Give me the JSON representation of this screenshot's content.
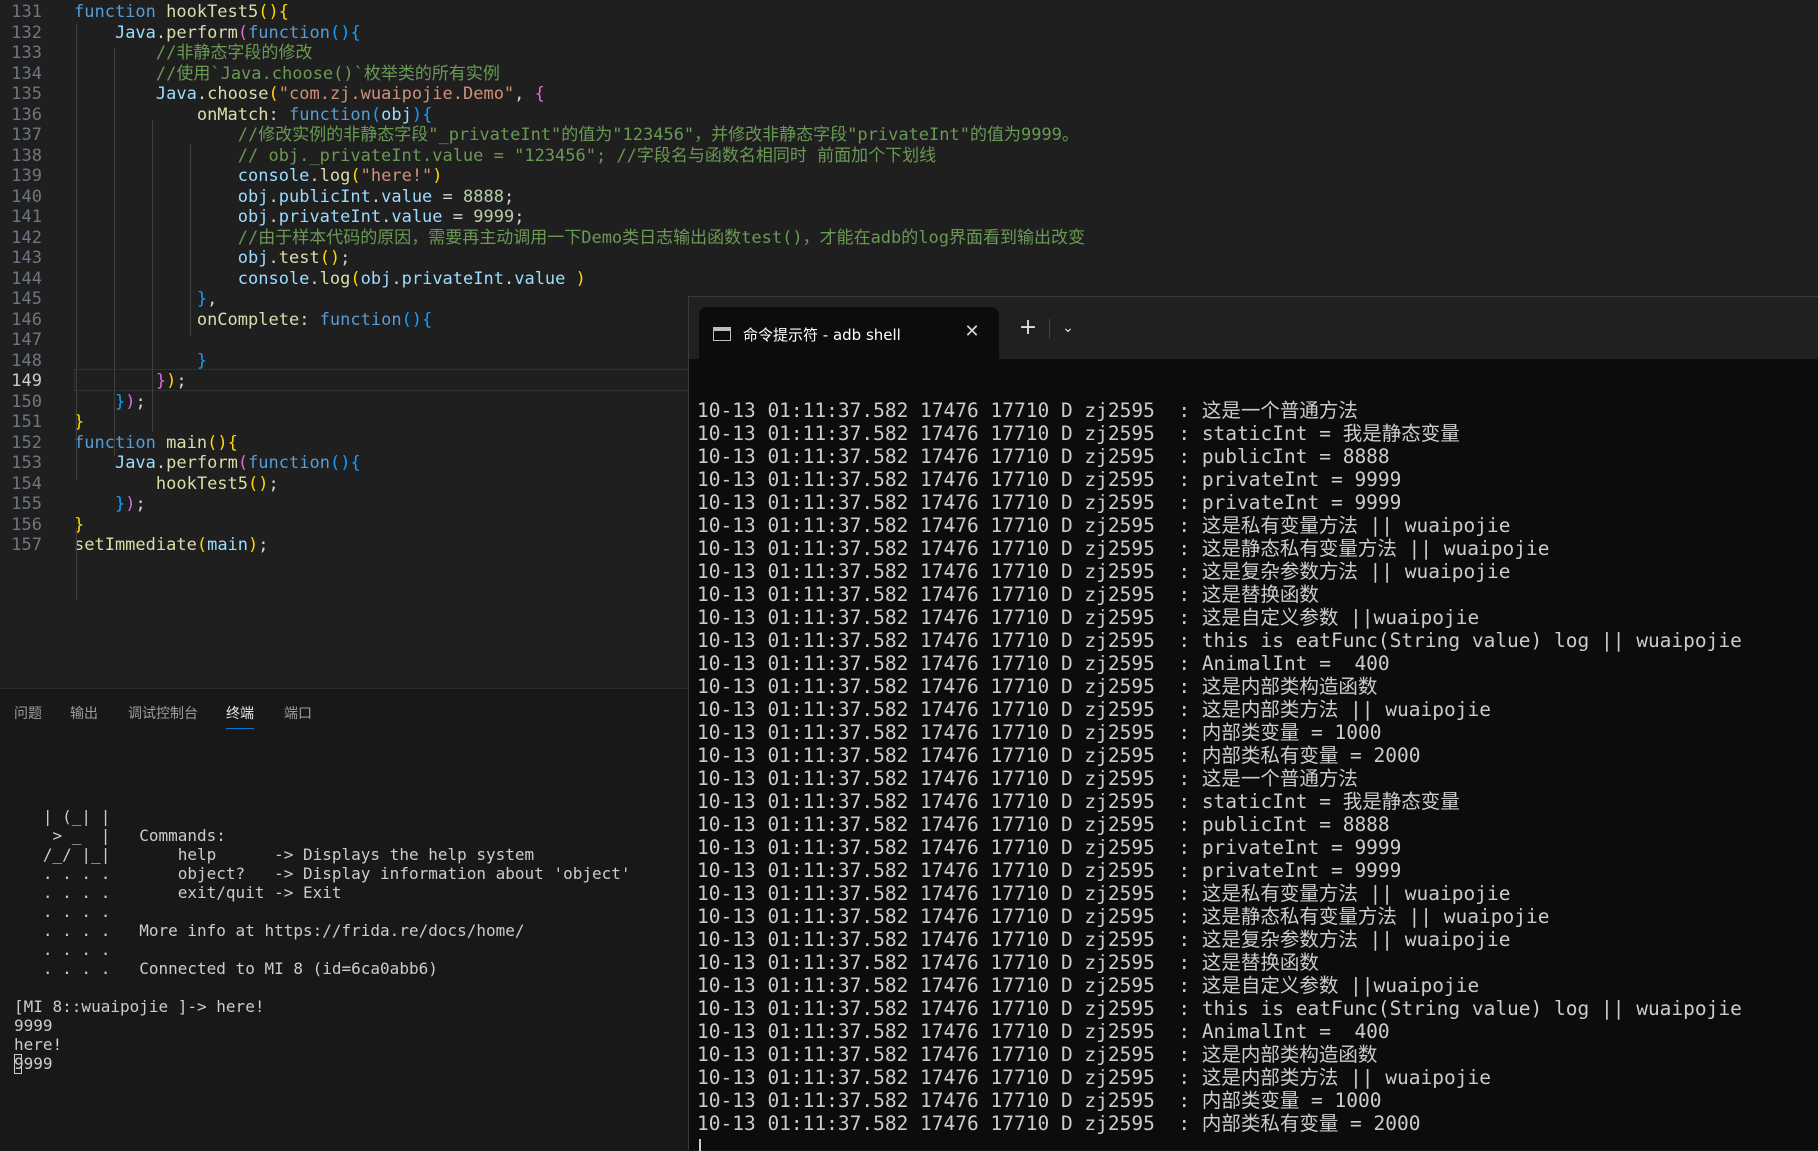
{
  "editor": {
    "lines": [
      {
        "num": "131",
        "tokens": [
          [
            "kw",
            "function "
          ],
          [
            "fn",
            "hookTest5"
          ],
          [
            "b1",
            "()"
          ],
          [
            "b1",
            "{"
          ]
        ]
      },
      {
        "num": "132",
        "tokens": [
          [
            "pl",
            "    "
          ],
          [
            "var",
            "Java"
          ],
          [
            "pl",
            "."
          ],
          [
            "fn",
            "perform"
          ],
          [
            "b2",
            "("
          ],
          [
            "kw",
            "function"
          ],
          [
            "b3",
            "()"
          ],
          [
            "b3",
            "{"
          ]
        ]
      },
      {
        "num": "133",
        "tokens": [
          [
            "cm",
            "        //非静态字段的修改"
          ]
        ]
      },
      {
        "num": "134",
        "tokens": [
          [
            "cm",
            "        //使用`Java.choose()`枚举类的所有实例"
          ]
        ]
      },
      {
        "num": "135",
        "tokens": [
          [
            "pl",
            "        "
          ],
          [
            "var",
            "Java"
          ],
          [
            "pl",
            "."
          ],
          [
            "fn",
            "choose"
          ],
          [
            "b1",
            "("
          ],
          [
            "str",
            "\"com.zj.wuaipojie.Demo\""
          ],
          [
            "pl",
            ", "
          ],
          [
            "b2",
            "{"
          ]
        ]
      },
      {
        "num": "136",
        "tokens": [
          [
            "pl",
            "            "
          ],
          [
            "fn",
            "onMatch"
          ],
          [
            "pl",
            ": "
          ],
          [
            "kw",
            "function"
          ],
          [
            "b3",
            "("
          ],
          [
            "var",
            "obj"
          ],
          [
            "b3",
            ")"
          ],
          [
            "b3",
            "{"
          ]
        ]
      },
      {
        "num": "137",
        "tokens": [
          [
            "cm",
            "                //修改实例的非静态字段\"_privateInt\"的值为\"123456\"，并修改非静态字段\"privateInt\"的值为9999。"
          ]
        ]
      },
      {
        "num": "138",
        "tokens": [
          [
            "cm",
            "                // obj._privateInt.value = \"123456\"; //字段名与函数名相同时 前面加个下划线"
          ]
        ]
      },
      {
        "num": "139",
        "tokens": [
          [
            "pl",
            "                "
          ],
          [
            "var",
            "console"
          ],
          [
            "pl",
            "."
          ],
          [
            "fn",
            "log"
          ],
          [
            "b1",
            "("
          ],
          [
            "str",
            "\"here!\""
          ],
          [
            "b1",
            ")"
          ]
        ]
      },
      {
        "num": "140",
        "tokens": [
          [
            "pl",
            "                "
          ],
          [
            "var",
            "obj"
          ],
          [
            "pl",
            "."
          ],
          [
            "var",
            "publicInt"
          ],
          [
            "pl",
            "."
          ],
          [
            "var",
            "value"
          ],
          [
            "pl",
            " = "
          ],
          [
            "num",
            "8888"
          ],
          [
            "pl",
            ";"
          ]
        ]
      },
      {
        "num": "141",
        "tokens": [
          [
            "pl",
            "                "
          ],
          [
            "var",
            "obj"
          ],
          [
            "pl",
            "."
          ],
          [
            "var",
            "privateInt"
          ],
          [
            "pl",
            "."
          ],
          [
            "var",
            "value"
          ],
          [
            "pl",
            " = "
          ],
          [
            "num",
            "9999"
          ],
          [
            "pl",
            ";"
          ]
        ]
      },
      {
        "num": "142",
        "tokens": [
          [
            "cm",
            "                //由于样本代码的原因，需要再主动调用一下Demo类日志输出函数test()，才能在adb的log界面看到输出改变"
          ]
        ]
      },
      {
        "num": "143",
        "tokens": [
          [
            "pl",
            "                "
          ],
          [
            "var",
            "obj"
          ],
          [
            "pl",
            "."
          ],
          [
            "fn",
            "test"
          ],
          [
            "b1",
            "()"
          ],
          [
            "pl",
            ";"
          ]
        ]
      },
      {
        "num": "144",
        "tokens": [
          [
            "pl",
            "                "
          ],
          [
            "var",
            "console"
          ],
          [
            "pl",
            "."
          ],
          [
            "fn",
            "log"
          ],
          [
            "b1",
            "("
          ],
          [
            "var",
            "obj"
          ],
          [
            "pl",
            "."
          ],
          [
            "var",
            "privateInt"
          ],
          [
            "pl",
            "."
          ],
          [
            "var",
            "value"
          ],
          [
            "pl",
            " "
          ],
          [
            "b1",
            ")"
          ]
        ]
      },
      {
        "num": "145",
        "tokens": [
          [
            "pl",
            "            "
          ],
          [
            "b3",
            "}"
          ],
          [
            "pl",
            ","
          ]
        ]
      },
      {
        "num": "146",
        "tokens": [
          [
            "pl",
            "            "
          ],
          [
            "fn",
            "onComplete"
          ],
          [
            "pl",
            ": "
          ],
          [
            "kw",
            "function"
          ],
          [
            "b3",
            "()"
          ],
          [
            "b3",
            "{"
          ]
        ]
      },
      {
        "num": "147",
        "tokens": []
      },
      {
        "num": "148",
        "tokens": [
          [
            "pl",
            "            "
          ],
          [
            "b3",
            "}"
          ]
        ]
      },
      {
        "num": "149",
        "tokens": [
          [
            "pl",
            "        "
          ],
          [
            "b2",
            "}"
          ],
          [
            "b1",
            ")"
          ],
          [
            "pl",
            ";"
          ]
        ]
      },
      {
        "num": "150",
        "tokens": [
          [
            "pl",
            "    "
          ],
          [
            "b3",
            "}"
          ],
          [
            "b2",
            ")"
          ],
          [
            "pl",
            ";"
          ]
        ]
      },
      {
        "num": "151",
        "tokens": [
          [
            "b1",
            "}"
          ]
        ]
      },
      {
        "num": "152",
        "tokens": [
          [
            "kw",
            "function "
          ],
          [
            "fn",
            "main"
          ],
          [
            "b1",
            "()"
          ],
          [
            "b1",
            "{"
          ]
        ]
      },
      {
        "num": "153",
        "tokens": [
          [
            "pl",
            "    "
          ],
          [
            "var",
            "Java"
          ],
          [
            "pl",
            "."
          ],
          [
            "fn",
            "perform"
          ],
          [
            "b2",
            "("
          ],
          [
            "kw",
            "function"
          ],
          [
            "b3",
            "()"
          ],
          [
            "b3",
            "{"
          ]
        ]
      },
      {
        "num": "154",
        "tokens": [
          [
            "pl",
            "        "
          ],
          [
            "fn",
            "hookTest5"
          ],
          [
            "b1",
            "()"
          ],
          [
            "pl",
            ";"
          ]
        ]
      },
      {
        "num": "155",
        "tokens": [
          [
            "pl",
            "    "
          ],
          [
            "b3",
            "}"
          ],
          [
            "b2",
            ")"
          ],
          [
            "pl",
            ";"
          ]
        ]
      },
      {
        "num": "156",
        "tokens": [
          [
            "b1",
            "}"
          ]
        ]
      },
      {
        "num": "157",
        "tokens": [
          [
            "fn",
            "setImmediate"
          ],
          [
            "b1",
            "("
          ],
          [
            "var",
            "main"
          ],
          [
            "b1",
            ")"
          ],
          [
            "pl",
            ";"
          ]
        ]
      }
    ],
    "current_line": "149"
  },
  "panel": {
    "tabs": [
      "问题",
      "输出",
      "调试控制台",
      "终端",
      "端口"
    ],
    "active_tab": "终端",
    "terminal_lines": [
      "   | (_| |",
      "    > _  |   Commands:",
      "   /_/ |_|       help      -> Displays the help system",
      "   . . . .       object?   -> Display information about 'object'",
      "   . . . .       exit/quit -> Exit",
      "   . . . .",
      "   . . . .   More info at https://frida.re/docs/home/",
      "   . . . .",
      "   . . . .   Connected to MI 8 (id=6ca0abb6)",
      "",
      "[MI 8::wuaipojie ]-> here!",
      "9999",
      "here!",
      "9999"
    ]
  },
  "wt": {
    "tab_title": "命令提示符 - adb  shell",
    "close_glyph": "✕",
    "new_tab_glyph": "+",
    "dropdown_glyph": "⌄",
    "log_lines": [
      "10-13 01:11:37.582 17476 17710 D zj2595  : 这是一个普通方法",
      "10-13 01:11:37.582 17476 17710 D zj2595  : staticInt = 我是静态变量",
      "10-13 01:11:37.582 17476 17710 D zj2595  : publicInt = 8888",
      "10-13 01:11:37.582 17476 17710 D zj2595  : privateInt = 9999",
      "10-13 01:11:37.582 17476 17710 D zj2595  : privateInt = 9999",
      "10-13 01:11:37.582 17476 17710 D zj2595  : 这是私有变量方法 || wuaipojie",
      "10-13 01:11:37.582 17476 17710 D zj2595  : 这是静态私有变量方法 || wuaipojie",
      "10-13 01:11:37.582 17476 17710 D zj2595  : 这是复杂参数方法 || wuaipojie",
      "10-13 01:11:37.582 17476 17710 D zj2595  : 这是替换函数",
      "10-13 01:11:37.582 17476 17710 D zj2595  : 这是自定义参数 ||wuaipojie",
      "10-13 01:11:37.582 17476 17710 D zj2595  : this is eatFunc(String value) log || wuaipojie",
      "10-13 01:11:37.582 17476 17710 D zj2595  : AnimalInt =  400",
      "10-13 01:11:37.582 17476 17710 D zj2595  : 这是内部类构造函数",
      "10-13 01:11:37.582 17476 17710 D zj2595  : 这是内部类方法 || wuaipojie",
      "10-13 01:11:37.582 17476 17710 D zj2595  : 内部类变量 = 1000",
      "10-13 01:11:37.582 17476 17710 D zj2595  : 内部类私有变量 = 2000",
      "10-13 01:11:37.582 17476 17710 D zj2595  : 这是一个普通方法",
      "10-13 01:11:37.582 17476 17710 D zj2595  : staticInt = 我是静态变量",
      "10-13 01:11:37.582 17476 17710 D zj2595  : publicInt = 8888",
      "10-13 01:11:37.582 17476 17710 D zj2595  : privateInt = 9999",
      "10-13 01:11:37.582 17476 17710 D zj2595  : privateInt = 9999",
      "10-13 01:11:37.582 17476 17710 D zj2595  : 这是私有变量方法 || wuaipojie",
      "10-13 01:11:37.582 17476 17710 D zj2595  : 这是静态私有变量方法 || wuaipojie",
      "10-13 01:11:37.582 17476 17710 D zj2595  : 这是复杂参数方法 || wuaipojie",
      "10-13 01:11:37.582 17476 17710 D zj2595  : 这是替换函数",
      "10-13 01:11:37.582 17476 17710 D zj2595  : 这是自定义参数 ||wuaipojie",
      "10-13 01:11:37.582 17476 17710 D zj2595  : this is eatFunc(String value) log || wuaipojie",
      "10-13 01:11:37.582 17476 17710 D zj2595  : AnimalInt =  400",
      "10-13 01:11:37.582 17476 17710 D zj2595  : 这是内部类构造函数",
      "10-13 01:11:37.582 17476 17710 D zj2595  : 这是内部类方法 || wuaipojie",
      "10-13 01:11:37.582 17476 17710 D zj2595  : 内部类变量 = 1000",
      "10-13 01:11:37.582 17476 17710 D zj2595  : 内部类私有变量 = 2000"
    ]
  },
  "colors": {
    "editor_bg": "#1f1f1f",
    "terminal_bg": "#0c0c0c",
    "keyword": "#569cd6",
    "function": "#dcdcaa",
    "variable": "#9cdcfe",
    "string": "#ce9178",
    "number": "#b5cea8",
    "comment": "#6a9955",
    "active_tab_underline": "#0078d4"
  }
}
